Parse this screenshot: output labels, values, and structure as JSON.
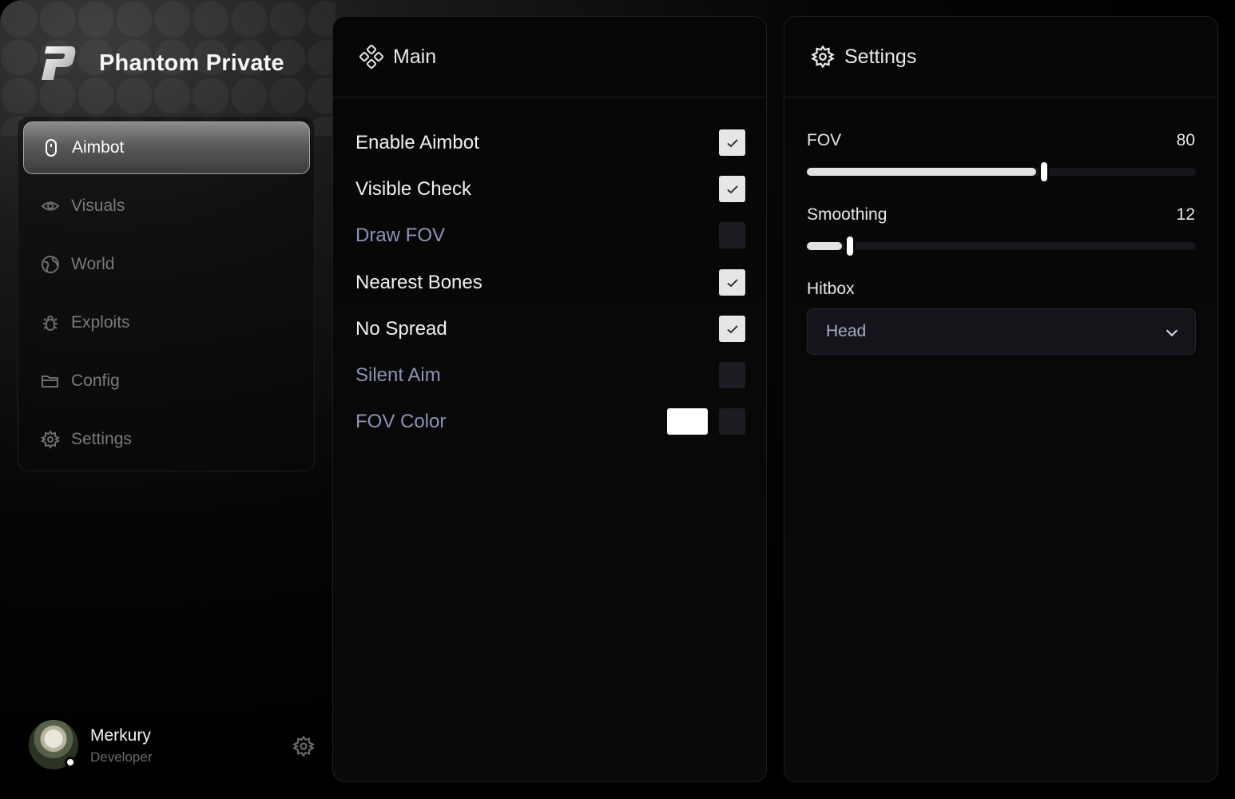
{
  "app": {
    "title": "Phantom Private"
  },
  "sidebar": {
    "items": [
      {
        "label": "Aimbot",
        "icon": "mouse-icon",
        "active": true
      },
      {
        "label": "Visuals",
        "icon": "eye-icon",
        "active": false
      },
      {
        "label": "World",
        "icon": "globe-icon",
        "active": false
      },
      {
        "label": "Exploits",
        "icon": "bug-icon",
        "active": false
      },
      {
        "label": "Config",
        "icon": "folder-icon",
        "active": false
      },
      {
        "label": "Settings",
        "icon": "gear-icon",
        "active": false
      }
    ]
  },
  "user": {
    "name": "Merkury",
    "role": "Developer",
    "status": "online"
  },
  "main_panel": {
    "title": "Main",
    "icon": "diamond-grid-icon",
    "options": [
      {
        "label": "Enable Aimbot",
        "checked": true
      },
      {
        "label": "Visible Check",
        "checked": true
      },
      {
        "label": "Draw FOV",
        "checked": false
      },
      {
        "label": "Nearest Bones",
        "checked": true
      },
      {
        "label": "No Spread",
        "checked": true
      },
      {
        "label": "Silent Aim",
        "checked": false
      },
      {
        "label": "FOV Color",
        "checked": false,
        "color": "#ffffff"
      }
    ]
  },
  "settings_panel": {
    "title": "Settings",
    "icon": "gear-icon",
    "fov": {
      "label": "FOV",
      "value": "80",
      "fraction": 0.61
    },
    "smoothing": {
      "label": "Smoothing",
      "value": "12",
      "fraction": 0.11
    },
    "hitbox": {
      "label": "Hitbox",
      "selected": "Head"
    }
  },
  "colors": {
    "background": "#000000",
    "accent": "#e1e1e1",
    "dim_text": "#8f93b5",
    "checkbox_off": "#1c1c22"
  }
}
